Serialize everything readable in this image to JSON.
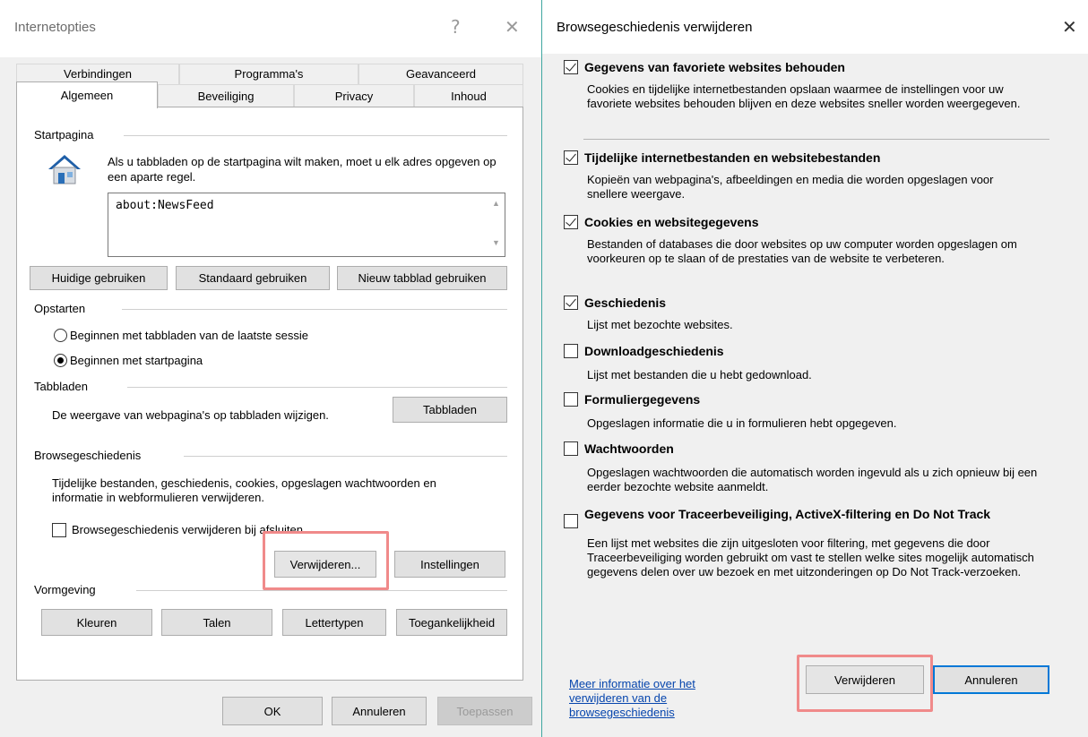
{
  "left_dialog": {
    "title": "Internetopties",
    "help_glyph": "?",
    "close_glyph": "✕",
    "tabs_row1": [
      "Verbindingen",
      "Programma's",
      "Geavanceerd"
    ],
    "tabs_row2": [
      "Algemeen",
      "Beveiliging",
      "Privacy",
      "Inhoud"
    ],
    "active_tab": "Algemeen",
    "startpagina": {
      "heading": "Startpagina",
      "description": "Als u tabbladen op de startpagina wilt maken, moet u elk adres opgeven op een aparte regel.",
      "url_value": "about:NewsFeed",
      "buttons": [
        "Huidige gebruiken",
        "Standaard gebruiken",
        "Nieuw tabblad gebruiken"
      ]
    },
    "opstarten": {
      "heading": "Opstarten",
      "options": [
        {
          "label": "Beginnen met tabbladen van de laatste sessie",
          "selected": false
        },
        {
          "label": "Beginnen met startpagina",
          "selected": true
        }
      ]
    },
    "tabbladen": {
      "heading": "Tabbladen",
      "description": "De weergave van webpagina's op tabbladen wijzigen.",
      "button": "Tabbladen"
    },
    "browsegeschiedenis": {
      "heading": "Browsegeschiedenis",
      "description": "Tijdelijke bestanden, geschiedenis, cookies, opgeslagen wachtwoorden en informatie in webformulieren verwijderen.",
      "checkbox_label": "Browsegeschiedenis verwijderen bij afsluiten",
      "checkbox_checked": false,
      "delete_button": "Verwijderen...",
      "settings_button": "Instellingen"
    },
    "vormgeving": {
      "heading": "Vormgeving",
      "buttons": [
        "Kleuren",
        "Talen",
        "Lettertypen",
        "Toegankelijkheid"
      ]
    },
    "footer": {
      "ok": "OK",
      "cancel": "Annuleren",
      "apply": "Toepassen"
    }
  },
  "right_dialog": {
    "title": "Browsegeschiedenis verwijderen",
    "close_glyph": "✕",
    "options": [
      {
        "title": "Gegevens van favoriete websites behouden",
        "desc": "Cookies en tijdelijke internetbestanden opslaan waarmee de instellingen voor uw favoriete websites behouden blijven en deze websites sneller worden weergegeven.",
        "checked": true
      },
      {
        "title": "Tijdelijke internetbestanden en websitebestanden",
        "desc": "Kopieën van webpagina's, afbeeldingen en media die worden opgeslagen voor snellere weergave.",
        "checked": true
      },
      {
        "title": "Cookies en websitegegevens",
        "desc": "Bestanden of databases die door websites op uw computer worden opgeslagen om voorkeuren op te slaan of de prestaties van de website te verbeteren.",
        "checked": true
      },
      {
        "title": "Geschiedenis",
        "desc": "Lijst met bezochte websites.",
        "checked": true
      },
      {
        "title": "Downloadgeschiedenis",
        "desc": "Lijst met bestanden die u hebt gedownload.",
        "checked": false
      },
      {
        "title": "Formuliergegevens",
        "desc": "Opgeslagen informatie die u in formulieren hebt opgegeven.",
        "checked": false
      },
      {
        "title": "Wachtwoorden",
        "desc": "Opgeslagen wachtwoorden die automatisch worden ingevuld als u zich opnieuw bij een eerder bezochte website aanmeldt.",
        "checked": false
      },
      {
        "title": "Gegevens voor Traceerbeveiliging, ActiveX-filtering en Do Not Track",
        "desc": "Een lijst met websites die zijn uitgesloten voor filtering, met gegevens die door Traceerbeveiliging worden gebruikt om vast te stellen welke sites mogelijk automatisch gegevens delen over uw bezoek en met uitzonderingen op Do Not Track-verzoeken.",
        "checked": false
      }
    ],
    "more_info_link": "Meer informatie over het verwijderen van de browsegeschiedenis",
    "delete_button": "Verwijderen",
    "cancel_button": "Annuleren"
  },
  "colors": {
    "highlight": "#f08a8a",
    "link": "#0645ad",
    "divider_accent": "#3fa7a0",
    "focus_border": "#0078d7"
  }
}
